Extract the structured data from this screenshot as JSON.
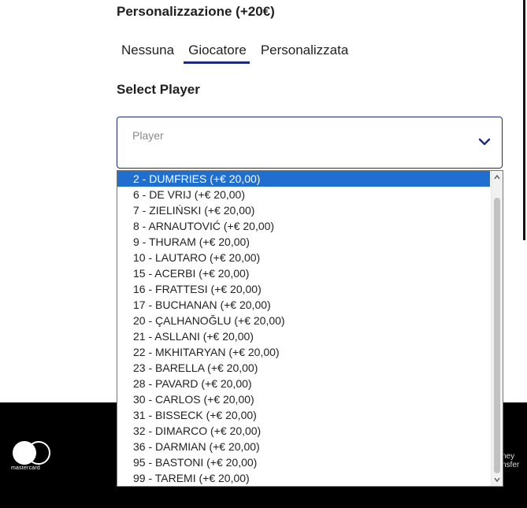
{
  "personalization": {
    "title": "Personalizzazione (+20€)",
    "tabs": [
      {
        "label": "Nessuna",
        "active": false
      },
      {
        "label": "Giocatore",
        "active": true
      },
      {
        "label": "Personalizzata",
        "active": false
      }
    ]
  },
  "player_select": {
    "title": "Select Player",
    "placeholder": "Player",
    "options": [
      "2 - DUMFRIES (+€ 20,00)",
      "6 - DE VRIJ (+€ 20,00)",
      "7 - ZIELIŃSKI (+€ 20,00)",
      "8 - ARNAUTOVIĆ (+€ 20,00)",
      "9 - THURAM (+€ 20,00)",
      "10 - LAUTARO (+€ 20,00)",
      "15 - ACERBI (+€ 20,00)",
      "16 - FRATTESI (+€ 20,00)",
      "17 - BUCHANAN (+€ 20,00)",
      "20 - ÇALHANOĞLU (+€ 20,00)",
      "21 - ASLLANI (+€ 20,00)",
      "22 - MKHITARYAN (+€ 20,00)",
      "23 - BARELLA (+€ 20,00)",
      "28 - PAVARD (+€ 20,00)",
      "30 - CARLOS (+€ 20,00)",
      "31 - BISSECK (+€ 20,00)",
      "32 - DIMARCO (+€ 20,00)",
      "36 - DARMIAN (+€ 20,00)",
      "95 - BASTONI (+€ 20,00)",
      "99 - TAREMI (+€ 20,00)"
    ],
    "highlighted_index": 0
  },
  "footer": {
    "mastercard_label": "mastercard",
    "side_text": [
      "ney",
      "nsfer"
    ]
  },
  "colors": {
    "accent": "#1d2a80",
    "highlight": "#1f6fd0",
    "footer_bg": "#000000"
  }
}
